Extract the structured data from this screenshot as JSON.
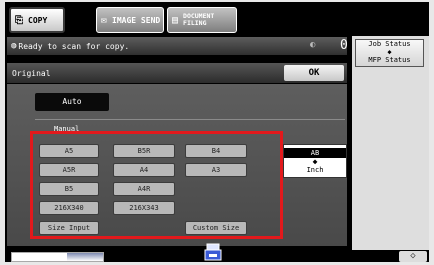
{
  "tabs": [
    {
      "label": "COPY",
      "icon": "copy-icon"
    },
    {
      "label": "IMAGE SEND",
      "icon": "image-send-icon"
    },
    {
      "label_line1": "DOCUMENT",
      "label_line2": "FILING",
      "icon": "document-filing-icon"
    }
  ],
  "status": {
    "message": "Ready to scan for copy.",
    "count": "0"
  },
  "right_panel": {
    "job_status": "Job Status",
    "arrow": "◆",
    "mfp_status": "MFP Status"
  },
  "original": {
    "title": "Original",
    "ok_label": "OK",
    "auto_label": "Auto",
    "manual_label": "Manual"
  },
  "sizes": {
    "a5": "A5",
    "b5r": "B5R",
    "b4": "B4",
    "a5r": "A5R",
    "a4": "A4",
    "a3": "A3",
    "b5": "B5",
    "a4r": "A4R",
    "s216x340": "216X340",
    "s216x343": "216X343",
    "size_input": "Size Input",
    "custom_size": "Custom Size"
  },
  "unit_toggle": {
    "selected": "AB",
    "arrow": "◆",
    "other": "Inch"
  },
  "bottom": {
    "progress_fraction": 0.6,
    "right_button": "◇"
  }
}
